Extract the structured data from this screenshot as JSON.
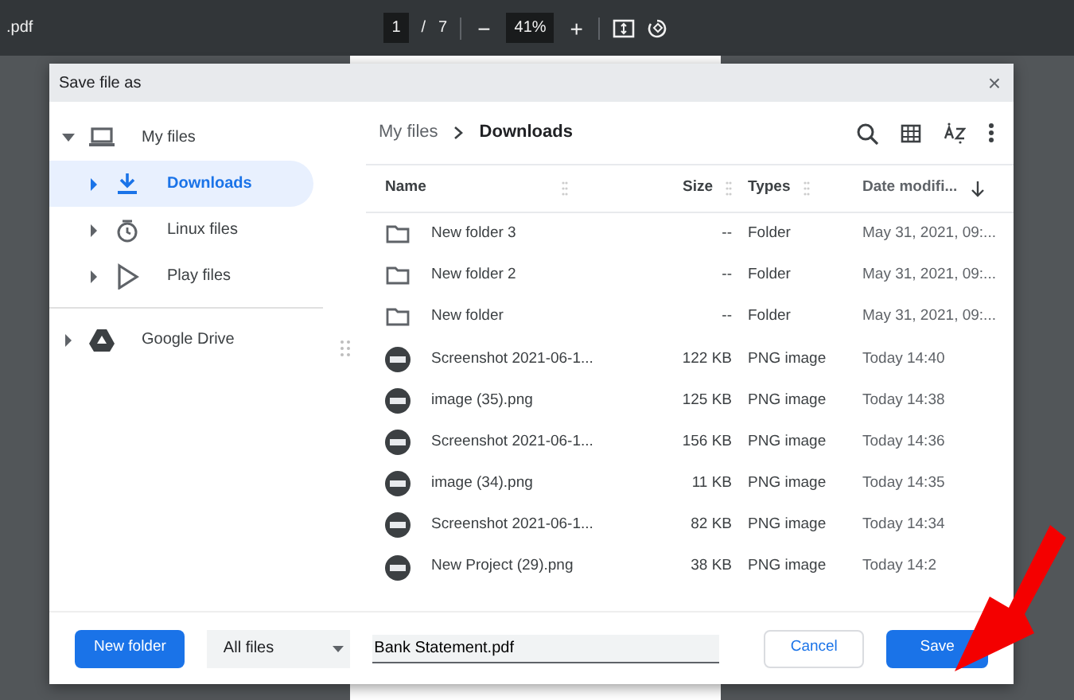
{
  "viewer": {
    "title": ".pdf",
    "page": "1",
    "page_sep": "/",
    "page_count": "7",
    "zoom_out": "−",
    "zoom": "41%",
    "zoom_in": "+"
  },
  "dialog": {
    "title": "Save file as",
    "close": "×"
  },
  "sidebar": {
    "items": [
      {
        "label": "My files",
        "kind": "laptop",
        "expanded": true,
        "selected": false,
        "children": [
          {
            "label": "Downloads",
            "kind": "download",
            "expanded": false,
            "selected": true
          },
          {
            "label": "Linux files",
            "kind": "linux",
            "expanded": false,
            "selected": false
          },
          {
            "label": "Play files",
            "kind": "play",
            "expanded": false,
            "selected": false
          }
        ]
      },
      {
        "label": "Google Drive",
        "kind": "drive",
        "expanded": false,
        "selected": false
      }
    ]
  },
  "breadcrumb": [
    "My files",
    "Downloads"
  ],
  "table": {
    "columns": [
      "Name",
      "Size",
      "Types",
      "Date modifi..."
    ],
    "rows": [
      {
        "kind": "folder",
        "name": "New folder 3",
        "size": "--",
        "type": "Folder",
        "date": "May 31, 2021, 09:..."
      },
      {
        "kind": "folder",
        "name": "New folder 2",
        "size": "--",
        "type": "Folder",
        "date": "May 31, 2021, 09:..."
      },
      {
        "kind": "folder",
        "name": "New folder",
        "size": "--",
        "type": "Folder",
        "date": "May 31, 2021, 09:..."
      },
      {
        "kind": "image",
        "name": "Screenshot 2021-06-1...",
        "size": "122 KB",
        "type": "PNG image",
        "date": "Today 14:40"
      },
      {
        "kind": "image",
        "name": "image (35).png",
        "size": "125 KB",
        "type": "PNG image",
        "date": "Today 14:38"
      },
      {
        "kind": "image",
        "name": "Screenshot 2021-06-1...",
        "size": "156 KB",
        "type": "PNG image",
        "date": "Today 14:36"
      },
      {
        "kind": "image",
        "name": "image (34).png",
        "size": "11 KB",
        "type": "PNG image",
        "date": "Today 14:35"
      },
      {
        "kind": "image",
        "name": "Screenshot 2021-06-1...",
        "size": "82 KB",
        "type": "PNG image",
        "date": "Today 14:34"
      },
      {
        "kind": "image",
        "name": "New Project (29).png",
        "size": "38 KB",
        "type": "PNG image",
        "date": "Today 14:2"
      }
    ]
  },
  "footer": {
    "new_folder": "New folder",
    "filter": "All files",
    "filename": "Bank Statement.pdf",
    "cancel": "Cancel",
    "save": "Save"
  }
}
